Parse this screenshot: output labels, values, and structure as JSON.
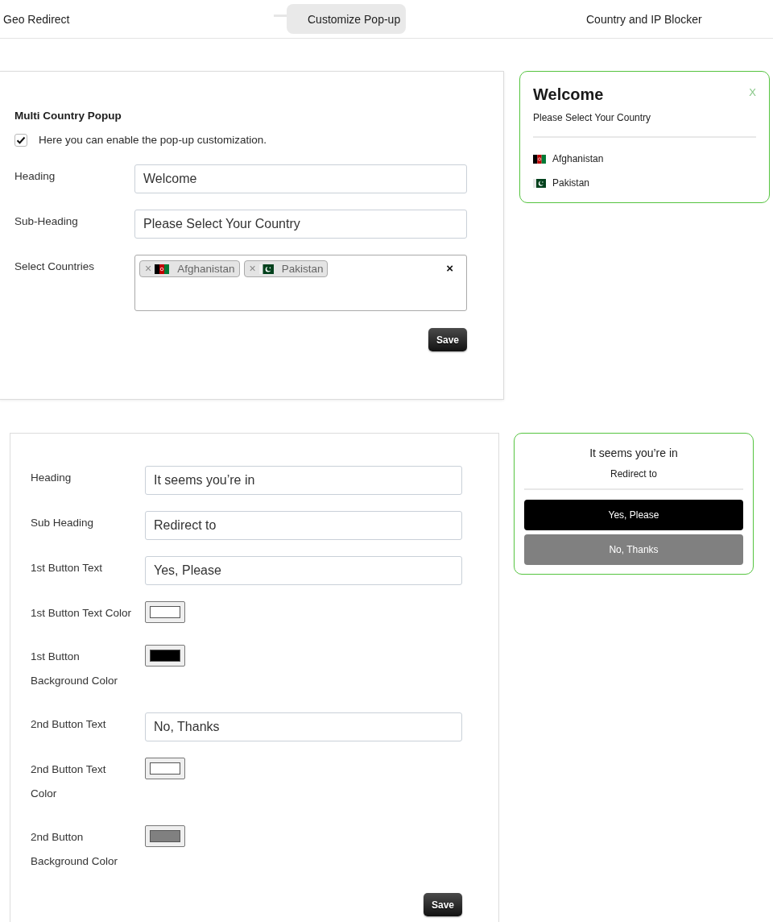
{
  "tabs": [
    {
      "label": "Geo Redirect",
      "selected": false
    },
    {
      "label": "Customize Pop-up",
      "selected": true
    },
    {
      "label": "Country and IP Blocker",
      "selected": false
    }
  ],
  "multi_country_popup": {
    "title": "Multi Country Popup",
    "enable": {
      "label": "Here you can enable the pop-up customization.",
      "checked": true
    },
    "fields": [
      {
        "kind": "text",
        "label": "Heading",
        "value": "Welcome"
      },
      {
        "kind": "text",
        "label": "Sub-Heading",
        "value": "Please Select Your Country"
      },
      {
        "kind": "tags",
        "label": "Select Countries",
        "tags": [
          {
            "kind": "af",
            "label": "Afghanistan",
            "remove": "×"
          },
          {
            "kind": "pk",
            "label": "Pakistan",
            "remove": "×"
          }
        ],
        "clear": "×"
      }
    ],
    "save": "Save"
  },
  "multi_country_preview": {
    "heading": "Welcome",
    "close": "X",
    "subheading": "Please Select Your Country",
    "countries": [
      {
        "kind": "af",
        "name": "Afghanistan"
      },
      {
        "kind": "pk",
        "name": "Pakistan"
      }
    ]
  },
  "redirect_popup": {
    "fields": [
      {
        "kind": "text",
        "label": "Heading",
        "value": "It seems you’re in"
      },
      {
        "kind": "text",
        "label": "Sub Heading",
        "value": "Redirect to"
      },
      {
        "kind": "text",
        "label": "1st Button Text",
        "value": "Yes, Please"
      },
      {
        "kind": "color",
        "label": "1st Button Text Color",
        "color": "#ffffff"
      },
      {
        "kind": "color",
        "label": "1st Button Background Color",
        "color": "#000000"
      },
      {
        "kind": "text",
        "label": "2nd Button Text",
        "value": "No, Thanks"
      },
      {
        "kind": "color",
        "label": "2nd Button Text Color",
        "color": "#ffffff"
      },
      {
        "kind": "color",
        "label": "2nd Button Background Color",
        "color": "#808080"
      }
    ],
    "save": "Save"
  },
  "redirect_preview": {
    "heading": "It seems you’re in",
    "subheading": "Redirect to",
    "buttons": [
      {
        "label": "Yes, Please",
        "color": "#000000"
      },
      {
        "label": "No, Thanks",
        "color": "#808080"
      }
    ]
  }
}
